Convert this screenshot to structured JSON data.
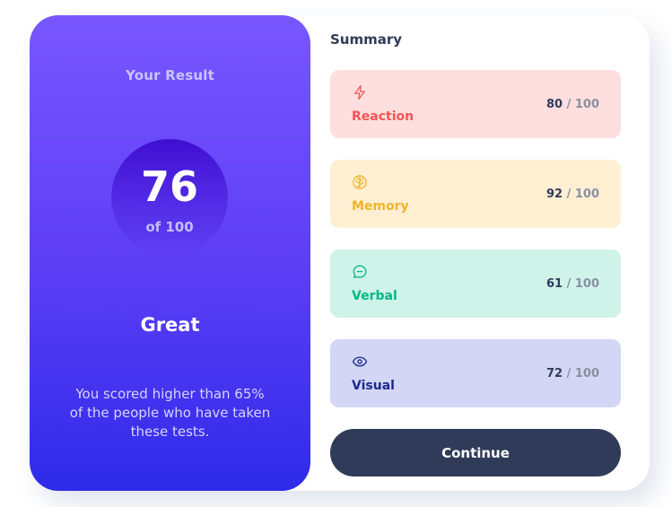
{
  "result": {
    "title": "Your Result",
    "score": "76",
    "score_of": "of 100",
    "grade": "Great",
    "description": "You scored higher than 65% of the people who have taken these tests."
  },
  "summary": {
    "title": "Summary",
    "items": [
      {
        "label": "Reaction",
        "score": "80",
        "max": " / 100",
        "icon": "lightning-icon",
        "color": "#f55454",
        "bg": "#ffdfde"
      },
      {
        "label": "Memory",
        "score": "92",
        "max": " / 100",
        "icon": "brain-icon",
        "color": "#f0b42a",
        "bg": "#ffefd2"
      },
      {
        "label": "Verbal",
        "score": "61",
        "max": " / 100",
        "icon": "chat-bubble-icon",
        "color": "#00b886",
        "bg": "#cff2e9"
      },
      {
        "label": "Visual",
        "score": "72",
        "max": " / 100",
        "icon": "eye-icon",
        "color": "#1c2a8e",
        "bg": "#d3d6f4"
      }
    ]
  },
  "actions": {
    "continue_label": "Continue"
  }
}
